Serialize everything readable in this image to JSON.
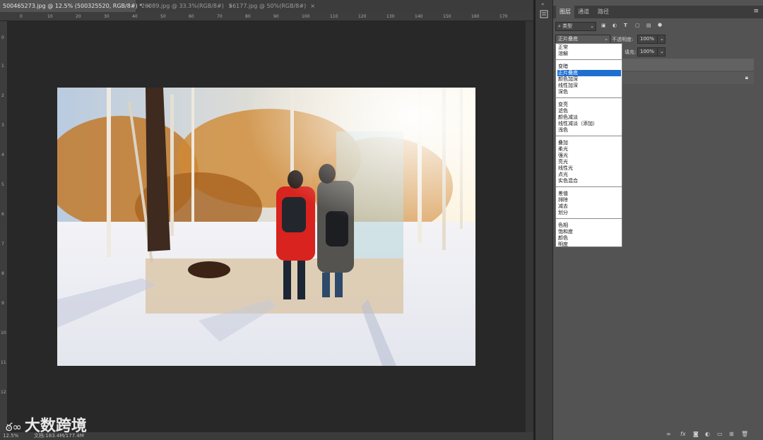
{
  "tabs": [
    {
      "title": "500465273.jpg @ 12.5% (500325520, RGB/8#) *",
      "active": true
    },
    {
      "title": "26089.jpg @ 33.3%(RGB/8#)",
      "active": false
    },
    {
      "title": "56177.jpg @ 50%(RGB/8#)",
      "active": false
    }
  ],
  "tab_close_glyph": "×",
  "ruler_top": [
    "0",
    "10",
    "20",
    "30",
    "40",
    "50",
    "60",
    "70",
    "80",
    "90",
    "100",
    "110",
    "120",
    "130",
    "140",
    "150",
    "160",
    "170"
  ],
  "ruler_left": [
    "0",
    "1",
    "2",
    "3",
    "4",
    "5",
    "6",
    "7",
    "8",
    "9",
    "10",
    "11",
    "12"
  ],
  "status": {
    "zoom": "12.5%",
    "doc": "文档:183.4M/177.4M"
  },
  "watermark": "大数跨境",
  "panel": {
    "tabs": [
      "图层",
      "通道",
      "路径"
    ],
    "filter_kind": "类型",
    "blend_mode": "正片叠底",
    "opacity_label": "不透明度:",
    "opacity_value": "100%",
    "fill_label": "填充:",
    "fill_value": "100%",
    "menu_glyph": "≡",
    "collapse_glyph": "«"
  },
  "blend_menu": {
    "groups": [
      [
        "正常",
        "溶解"
      ],
      [
        "变暗",
        "正片叠底",
        "颜色加深",
        "线性加深",
        "深色"
      ],
      [
        "变亮",
        "滤色",
        "颜色减淡",
        "线性减淡（添加）",
        "浅色"
      ],
      [
        "叠加",
        "柔光",
        "强光",
        "亮光",
        "线性光",
        "点光",
        "实色混合"
      ],
      [
        "差值",
        "排除",
        "减去",
        "划分"
      ],
      [
        "色相",
        "饱和度",
        "颜色",
        "明度"
      ]
    ],
    "selected": "正片叠底"
  },
  "colors": {
    "selection": "#1f6fd1",
    "panel": "#535353",
    "canvas": "#282828"
  }
}
